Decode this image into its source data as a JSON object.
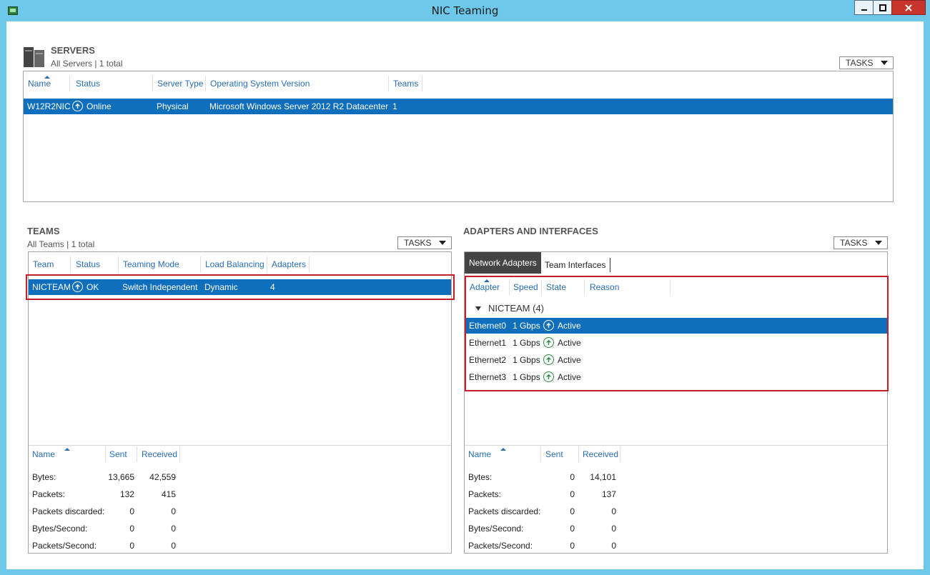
{
  "window": {
    "title": "NIC Teaming"
  },
  "servers": {
    "title": "SERVERS",
    "subtitle": "All Servers | 1 total",
    "tasks": "TASKS",
    "columns": [
      "Name",
      "Status",
      "Server Type",
      "Operating System Version",
      "Teams"
    ],
    "rows": [
      {
        "name": "W12R2NIC",
        "status": "Online",
        "type": "Physical",
        "os": "Microsoft Windows Server 2012 R2 Datacenter",
        "teams": "1"
      }
    ]
  },
  "teams": {
    "title": "TEAMS",
    "subtitle": "All Teams | 1 total",
    "tasks": "TASKS",
    "columns": [
      "Team",
      "Status",
      "Teaming Mode",
      "Load Balancing",
      "Adapters"
    ],
    "rows": [
      {
        "team": "NICTEAM",
        "status": "OK",
        "mode": "Switch Independent",
        "lb": "Dynamic",
        "adapters": "4"
      }
    ],
    "stats": {
      "columns": [
        "Name",
        "Sent",
        "Received"
      ],
      "rows": [
        {
          "label": "Bytes:",
          "sent": "13,665",
          "received": "42,559"
        },
        {
          "label": "Packets:",
          "sent": "132",
          "received": "415"
        },
        {
          "label": "Packets discarded:",
          "sent": "0",
          "received": "0"
        },
        {
          "label": "Bytes/Second:",
          "sent": "0",
          "received": "0"
        },
        {
          "label": "Packets/Second:",
          "sent": "0",
          "received": "0"
        }
      ]
    }
  },
  "adapters": {
    "title": "ADAPTERS AND INTERFACES",
    "tasks": "TASKS",
    "tabs": [
      "Network Adapters",
      "Team Interfaces"
    ],
    "columns": [
      "Adapter",
      "Speed",
      "State",
      "Reason"
    ],
    "group": "NICTEAM (4)",
    "rows": [
      {
        "adapter": "Ethernet0",
        "speed": "1 Gbps",
        "state": "Active"
      },
      {
        "adapter": "Ethernet1",
        "speed": "1 Gbps",
        "state": "Active"
      },
      {
        "adapter": "Ethernet2",
        "speed": "1 Gbps",
        "state": "Active"
      },
      {
        "adapter": "Ethernet3",
        "speed": "1 Gbps",
        "state": "Active"
      }
    ],
    "stats": {
      "columns": [
        "Name",
        "Sent",
        "Received"
      ],
      "rows": [
        {
          "label": "Bytes:",
          "sent": "0",
          "received": "14,101"
        },
        {
          "label": "Packets:",
          "sent": "0",
          "received": "137"
        },
        {
          "label": "Packets discarded:",
          "sent": "0",
          "received": "0"
        },
        {
          "label": "Bytes/Second:",
          "sent": "0",
          "received": "0"
        },
        {
          "label": "Packets/Second:",
          "sent": "0",
          "received": "0"
        }
      ]
    }
  },
  "colors": {
    "accent": "#0f6fbd",
    "header_text": "#2a6eb5",
    "highlight": "#c41f2a",
    "titlebar": "#6dc8ea"
  }
}
